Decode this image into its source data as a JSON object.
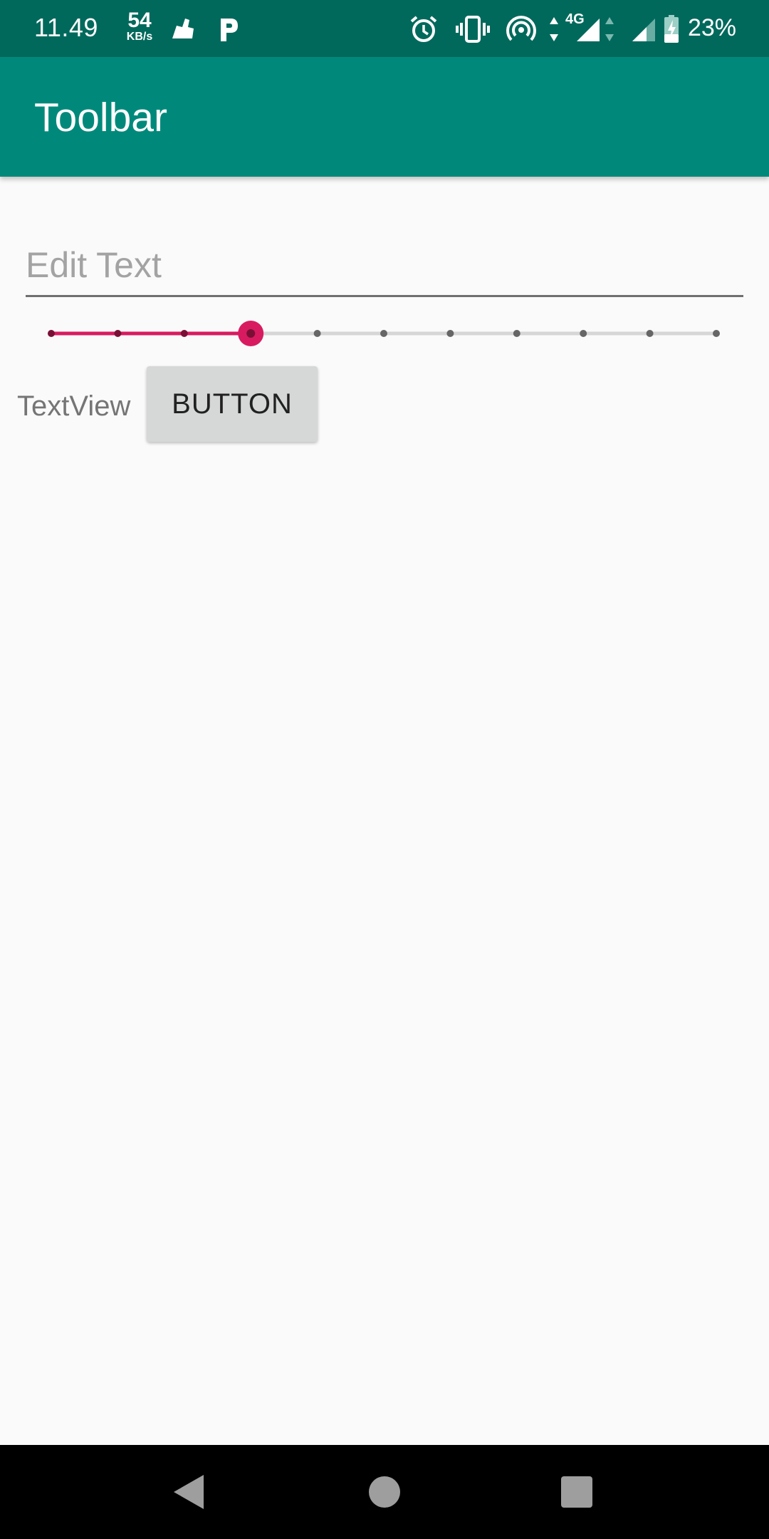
{
  "status_bar": {
    "time": "11.49",
    "net_speed_value": "54",
    "net_speed_unit": "KB/s",
    "network_type": "4G",
    "battery_percent": "23%",
    "icons": [
      "notification-app-icon",
      "parking-app-icon",
      "alarm-icon",
      "vibrate-icon",
      "hotspot-icon",
      "data-arrows-icon",
      "signal-icon",
      "signal-icon-2",
      "battery-charging-icon"
    ]
  },
  "toolbar": {
    "title": "Toolbar"
  },
  "edit_text": {
    "placeholder": "Edit Text",
    "value": ""
  },
  "seekbar": {
    "min": 0,
    "max": 10,
    "value": 3,
    "accent_color": "#d81b60",
    "track_color": "#d6d6d6"
  },
  "text_view": {
    "text": "TextView"
  },
  "button": {
    "label": "BUTTON"
  },
  "colors": {
    "status_bar": "#00695c",
    "toolbar": "#00897b",
    "background": "#fafafa",
    "accent": "#d81b60"
  },
  "nav_bar": {
    "buttons": [
      "back-icon",
      "home-icon",
      "recents-icon"
    ]
  }
}
